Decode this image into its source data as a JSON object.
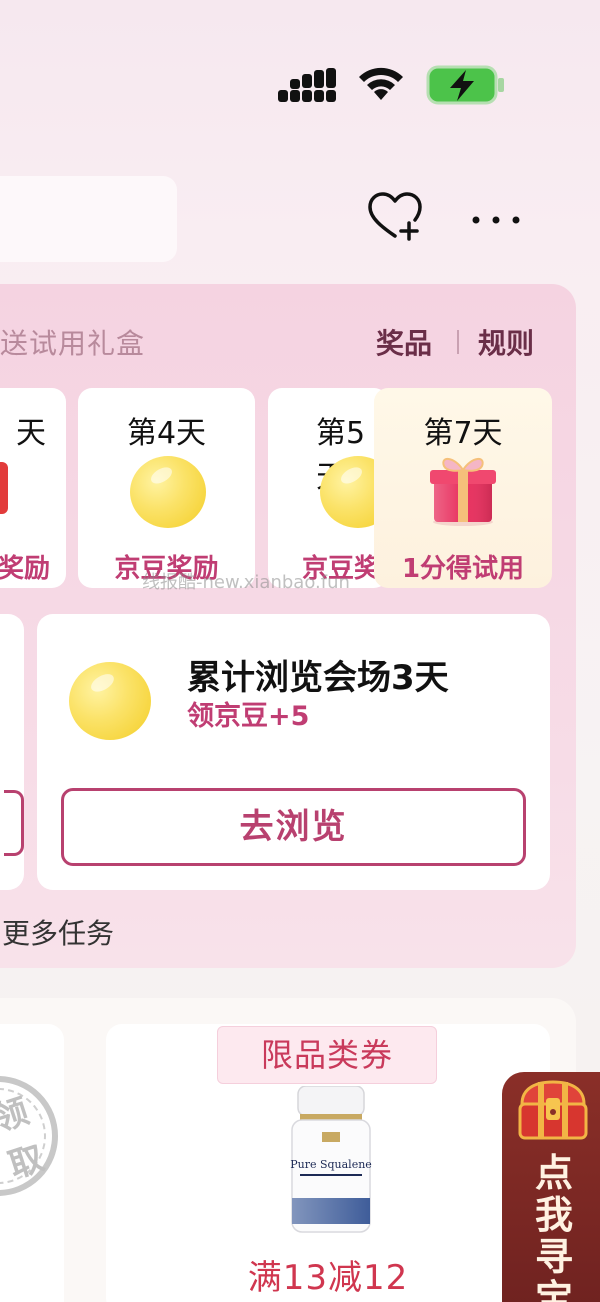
{
  "status_bar": {
    "icons": [
      "cellular-signal-icon",
      "wifi-icon",
      "battery-charging-icon"
    ],
    "battery_color": "#4cc34a"
  },
  "header": {
    "search_placeholder": "",
    "icons": [
      "heart-plus-icon",
      "more-icon"
    ]
  },
  "task_panel": {
    "title": "送试用礼盒",
    "links": {
      "prizes": "奖品",
      "rules": "规则"
    },
    "days": [
      {
        "label": "天",
        "reward": "奖励"
      },
      {
        "label": "第4天",
        "reward": "京豆奖励"
      },
      {
        "label": "第5天",
        "reward": "京豆奖"
      },
      {
        "label": "第7天",
        "reward": "1分得试用"
      }
    ],
    "browse_task": {
      "title": "累计浏览会场3天",
      "reward": "领京豆+5",
      "button": "去浏览"
    },
    "more_tasks": "更多任务"
  },
  "watermark": "线报酷-new.xianbao.fun",
  "coupon_section": {
    "stamp_text": "领取",
    "tag": "限品类券",
    "price": "满13减12",
    "product_label": "Pure Squalene"
  },
  "treasure": {
    "text": "点我寻宝"
  },
  "colors": {
    "accent": "#c03d73",
    "button_border": "#b8416f",
    "coupon_red": "#d0364f",
    "panel_pink": "#f5d3e1"
  }
}
